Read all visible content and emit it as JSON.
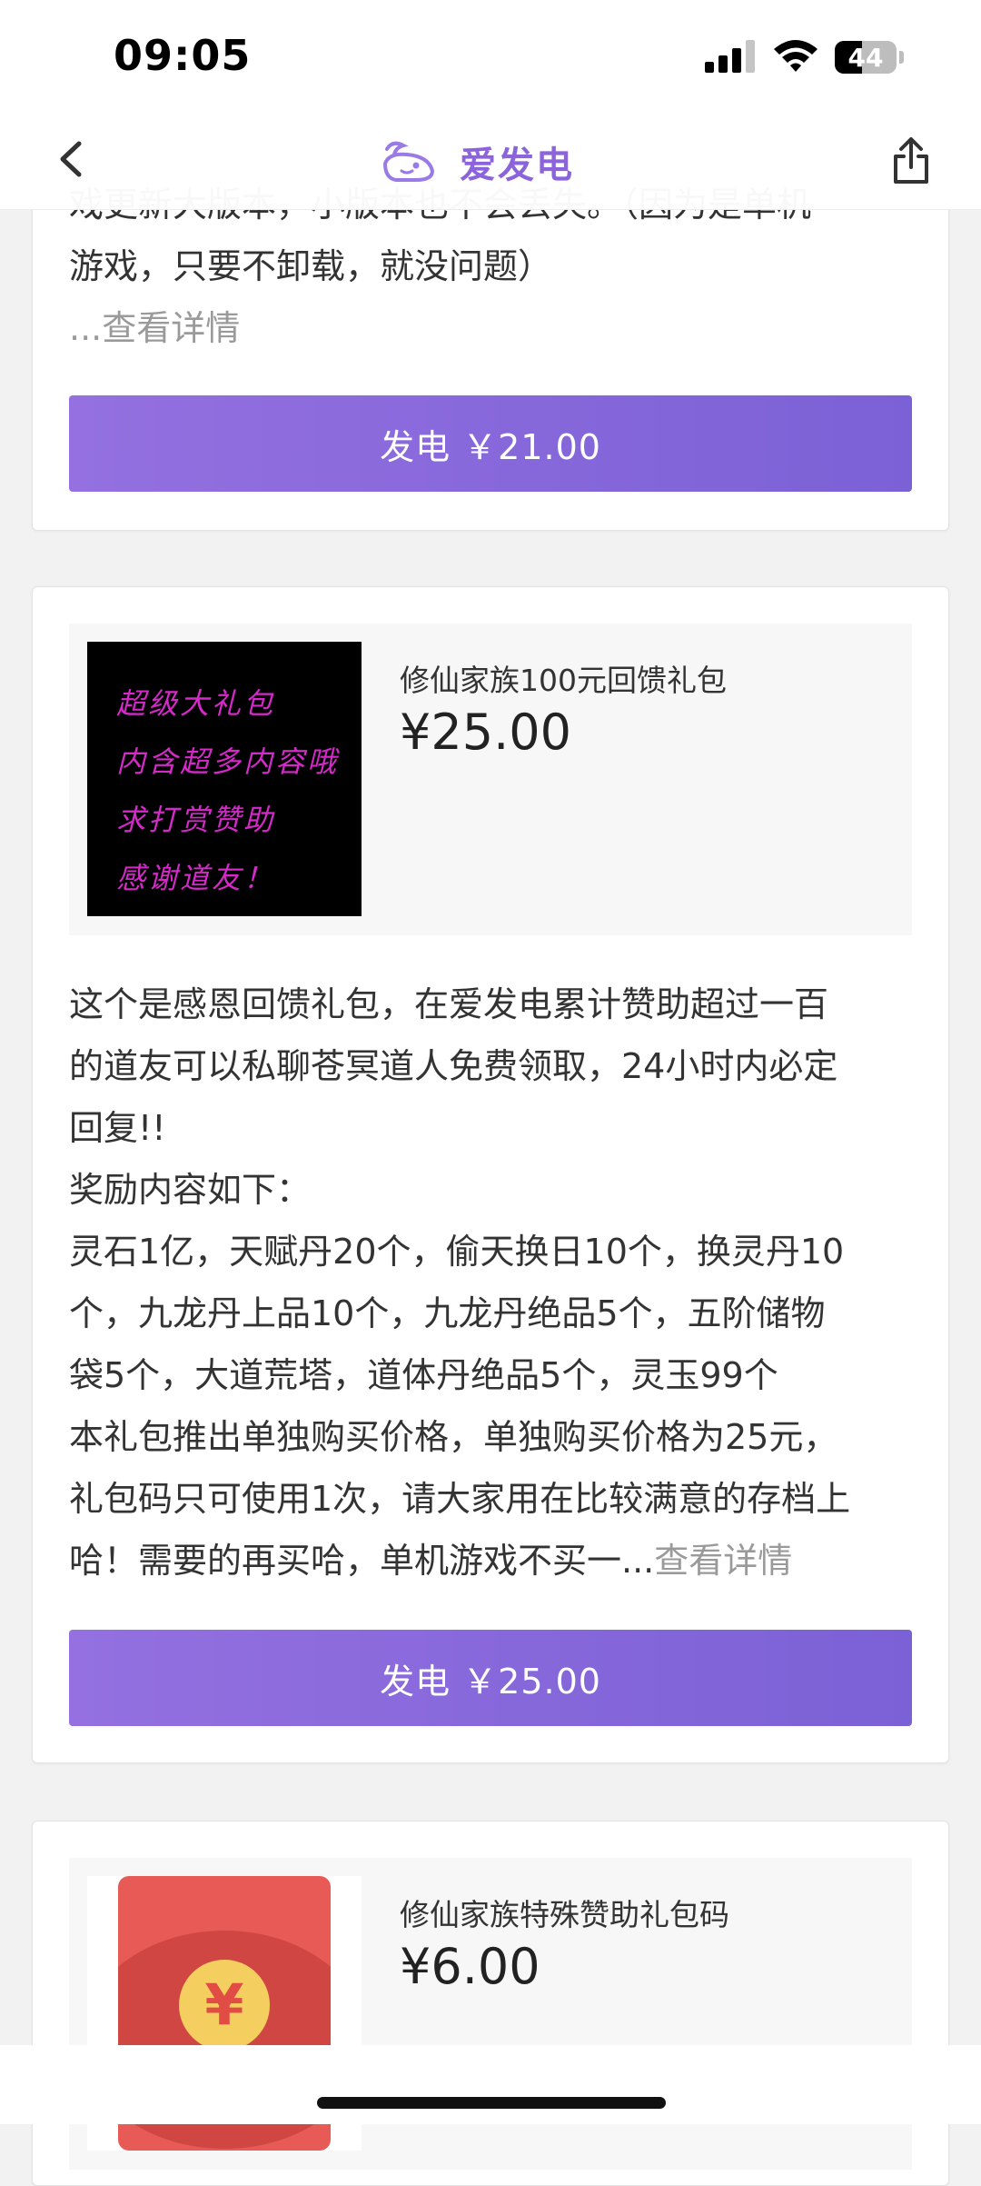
{
  "status_bar": {
    "time": "09:05",
    "battery": "44"
  },
  "nav": {
    "title": "爱发电"
  },
  "cards": [
    {
      "description": [
        "戏更新大版本，小版本也不会丢失。（因为是单机",
        "游戏，只要不卸载，就没问题）"
      ],
      "more": "...查看详情",
      "button_label": "发电 ￥21.00"
    },
    {
      "product_name": "修仙家族100元回馈礼包",
      "price": "¥25.00",
      "image_text": [
        "超级大礼包",
        "内含超多内容哦",
        "求打赏赞助",
        "感谢道友！"
      ],
      "description": [
        "这个是感恩回馈礼包，在爱发电累计赞助超过一百",
        "的道友可以私聊苍冥道人免费领取，24小时内必定",
        "回复!!",
        "奖励内容如下：",
        "灵石1亿，天赋丹20个，偷天换日10个，换灵丹10",
        "个，九龙丹上品10个，九龙丹绝品5个，五阶储物",
        "袋5个，大道荒塔，道体丹绝品5个，灵玉99个",
        "本礼包推出单独购买价格，单独购买价格为25元，",
        "礼包码只可使用1次，请大家用在比较满意的存档上"
      ],
      "last_line": "哈！需要的再买哈，单机游戏不买一...",
      "more": "查看详情",
      "button_label": "发电 ￥25.00"
    },
    {
      "product_name": "修仙家族特殊赞助礼包码",
      "price": "¥6.00",
      "coin_symbol": "¥"
    }
  ],
  "colors": {
    "accent": "#8b63db",
    "button_start": "#9470e0",
    "button_end": "#7b61d6",
    "gift_text": "#d52ac9",
    "envelope": "#e75a55"
  }
}
